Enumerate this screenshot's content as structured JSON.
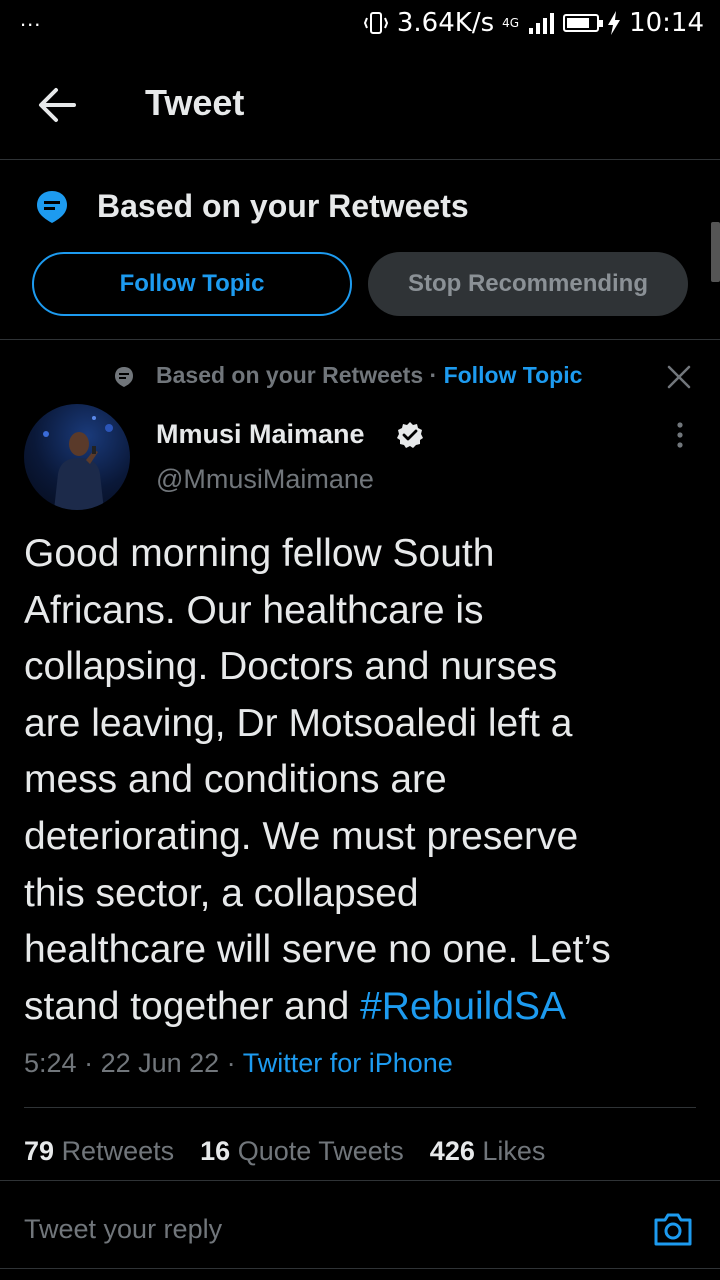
{
  "status_bar": {
    "dots": "...",
    "speed": "3.64K/s",
    "network": "4G",
    "time": "10:14"
  },
  "header": {
    "title": "Tweet"
  },
  "topic_banner": {
    "text": "Based on your Retweets",
    "follow_label": "Follow Topic",
    "stop_label": "Stop Recommending"
  },
  "tweet": {
    "context_text": "Based on your Retweets · ",
    "context_link": "Follow Topic",
    "author_name": "Mmusi Maimane",
    "author_handle": "@MmusiMaimane",
    "body": "Good morning fellow South\nAfricans. Our healthcare is\ncollapsing. Doctors and nurses\nare leaving, Dr Motsoaledi left a\nmess and conditions are\ndeteriorating. We must preserve\nthis sector, a collapsed\nhealthcare will serve no one. Let’s\nstand together and ",
    "hashtag": "#RebuildSA",
    "time": "5:24",
    "date": "22 Jun 22",
    "source": "Twitter for iPhone",
    "sep": " · "
  },
  "stats": {
    "retweets_count": "79",
    "retweets_label": "Retweets",
    "quotes_count": "16",
    "quotes_label": "Quote Tweets",
    "likes_count": "426",
    "likes_label": "Likes"
  },
  "reply": {
    "placeholder": "Tweet your reply"
  },
  "colors": {
    "accent": "#1d9bf0",
    "background": "#000000",
    "muted": "#71767b"
  }
}
